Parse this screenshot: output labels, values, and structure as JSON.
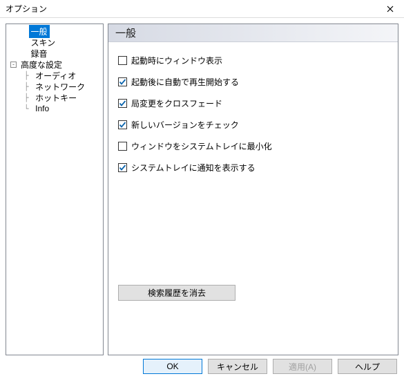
{
  "window": {
    "title": "オプション"
  },
  "tree": {
    "items": [
      {
        "label": "一般",
        "level": 0,
        "selected": true
      },
      {
        "label": "スキン",
        "level": 0
      },
      {
        "label": "録音",
        "level": 0
      },
      {
        "label": "高度な設定",
        "level": 0,
        "expander": "-"
      },
      {
        "label": "オーディオ",
        "level": 1
      },
      {
        "label": "ネットワーク",
        "level": 1
      },
      {
        "label": "ホットキー",
        "level": 1
      },
      {
        "label": "Info",
        "level": 1
      }
    ]
  },
  "panel": {
    "title": "一般",
    "checks": [
      {
        "label": "起動時にウィンドウ表示",
        "checked": false
      },
      {
        "label": "起動後に自動で再生開始する",
        "checked": true
      },
      {
        "label": "局変更をクロスフェード",
        "checked": true
      },
      {
        "label": "新しいバージョンをチェック",
        "checked": true
      },
      {
        "label": "ウィンドウをシステムトレイに最小化",
        "checked": false
      },
      {
        "label": "システムトレイに通知を表示する",
        "checked": true
      }
    ],
    "clear_history_label": "検索履歴を消去"
  },
  "footer": {
    "ok": "OK",
    "cancel": "キャンセル",
    "apply": "適用(A)",
    "help": "ヘルプ",
    "apply_enabled": false
  }
}
